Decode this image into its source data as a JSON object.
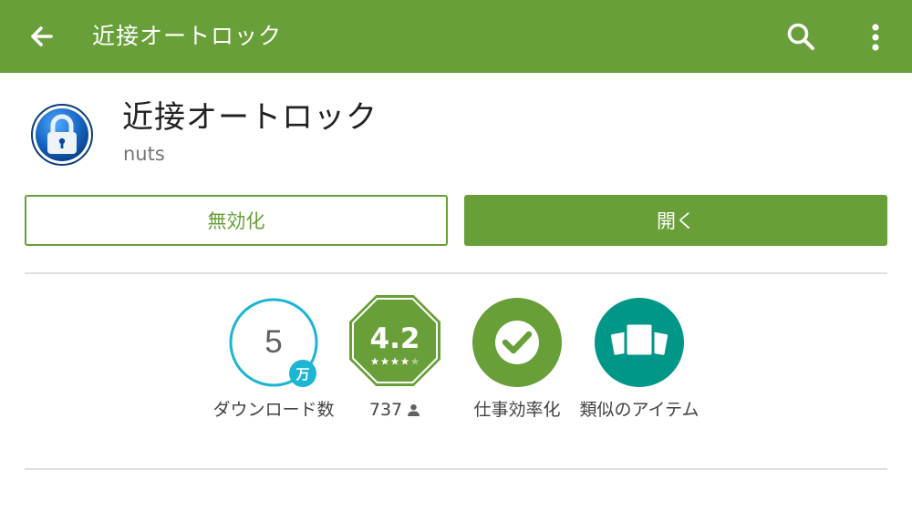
{
  "appbar": {
    "title": "近接オートロック",
    "back_icon": "arrow-left-icon",
    "search_icon": "search-icon",
    "more_icon": "more-vert-icon",
    "background_color": "#689f38"
  },
  "app": {
    "name": "近接オートロック",
    "developer": "nuts",
    "icon": "padlock-icon"
  },
  "actions": {
    "disable_label": "無効化",
    "open_label": "開く"
  },
  "badges": {
    "downloads": {
      "value": "5",
      "unit": "万",
      "label": "ダウンロード数"
    },
    "rating": {
      "value": "4.2",
      "stars": 4.2,
      "count": "737",
      "count_icon": "person-icon"
    },
    "category": {
      "label": "仕事効率化",
      "icon": "check-icon"
    },
    "similar": {
      "label": "類似のアイテム",
      "icon": "cards-icon"
    }
  },
  "colors": {
    "accent": "#689f38",
    "downloads_ring": "#1cb5d4",
    "similar_badge": "#009688"
  }
}
